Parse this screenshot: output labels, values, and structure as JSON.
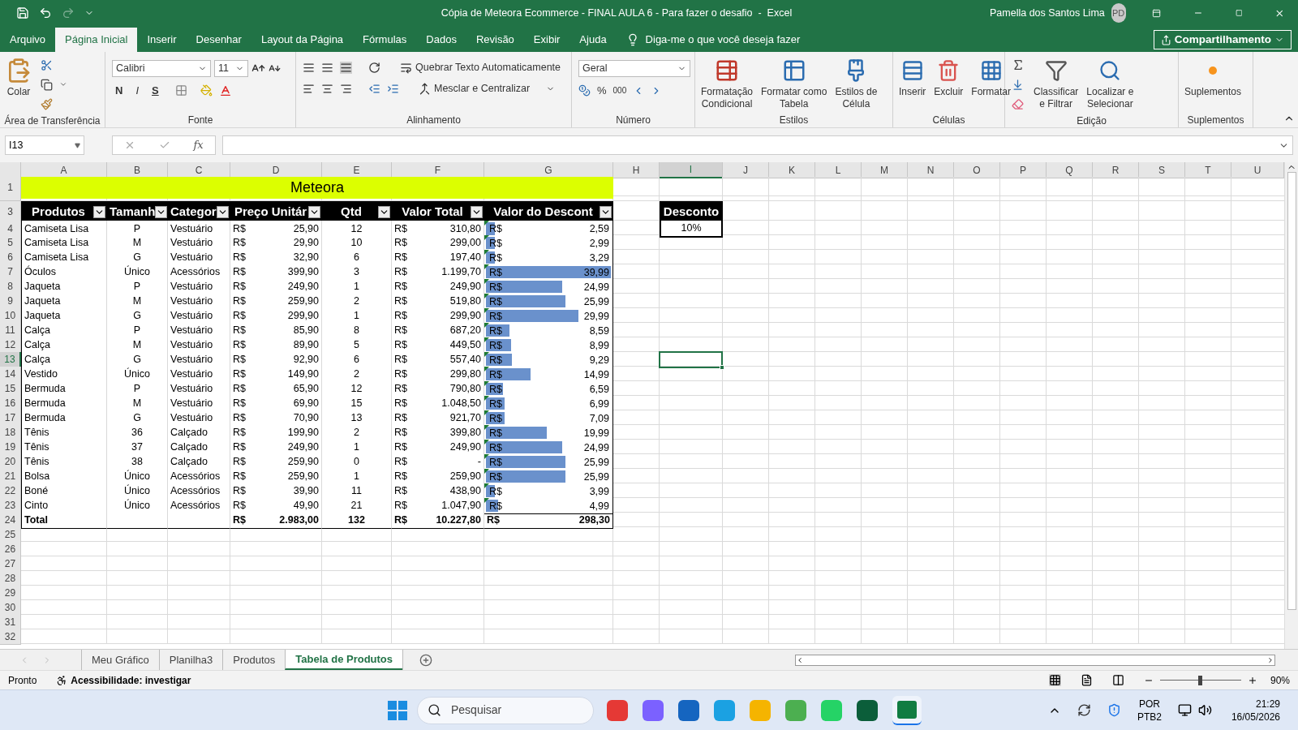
{
  "title_bar": {
    "title": "Cópia de Meteora Ecommerce - FINAL AULA 6 - Para fazer o desafio  -  Excel",
    "user": "Pamella dos Santos Lima",
    "avatar": "PD"
  },
  "menu_tabs": [
    {
      "label": "Arquivo",
      "selected": false
    },
    {
      "label": "Página Inicial",
      "selected": true
    },
    {
      "label": "Inserir",
      "selected": false
    },
    {
      "label": "Desenhar",
      "selected": false
    },
    {
      "label": "Layout da Página",
      "selected": false
    },
    {
      "label": "Fórmulas",
      "selected": false
    },
    {
      "label": "Dados",
      "selected": false
    },
    {
      "label": "Revisão",
      "selected": false
    },
    {
      "label": "Exibir",
      "selected": false
    },
    {
      "label": "Ajuda",
      "selected": false
    }
  ],
  "tell_me": "Diga-me o que você deseja fazer",
  "share_button": "Compartilhamento",
  "ribbon": {
    "clipboard": {
      "label": "Área de Transferência",
      "paste": "Colar"
    },
    "font": {
      "label": "Fonte",
      "font_name": "Calibri",
      "font_size": "11",
      "bold": "N",
      "italic": "I",
      "underline": "S"
    },
    "alignment": {
      "label": "Alinhamento",
      "wrap": "Quebrar Texto Automaticamente",
      "merge": "Mesclar e Centralizar"
    },
    "number": {
      "label": "Número",
      "format": "Geral",
      "percent": "%",
      "thousands": "000"
    },
    "styles": {
      "label": "Estilos",
      "buttons": [
        [
          "Formatação",
          "Condicional"
        ],
        [
          "Formatar como",
          "Tabela"
        ],
        [
          "Estilos de",
          "Célula"
        ]
      ]
    },
    "cells": {
      "label": "Células",
      "buttons": [
        "Inserir",
        "Excluir",
        "Formatar"
      ]
    },
    "editing": {
      "label": "Edição",
      "buttons": [
        [
          "Classificar",
          "e Filtrar"
        ],
        [
          "Localizar e",
          "Selecionar"
        ]
      ]
    },
    "addins": {
      "label": "Suplementos",
      "button": "Suplementos"
    }
  },
  "formula_bar": {
    "name_box": "I13",
    "function_label": "fx"
  },
  "columns": [
    {
      "label": "A",
      "selected": false
    },
    {
      "label": "B",
      "selected": false
    },
    {
      "label": "C",
      "selected": false
    },
    {
      "label": "D",
      "selected": false
    },
    {
      "label": "E",
      "selected": false
    },
    {
      "label": "F",
      "selected": false
    },
    {
      "label": "G",
      "selected": false
    },
    {
      "label": "H",
      "selected": false
    },
    {
      "label": "I",
      "selected": true
    },
    {
      "label": "J",
      "selected": false
    },
    {
      "label": "K",
      "selected": false
    },
    {
      "label": "L",
      "selected": false
    },
    {
      "label": "M",
      "selected": false
    },
    {
      "label": "N",
      "selected": false
    },
    {
      "label": "O",
      "selected": false
    },
    {
      "label": "P",
      "selected": false
    },
    {
      "label": "Q",
      "selected": false
    },
    {
      "label": "R",
      "selected": false
    },
    {
      "label": "S",
      "selected": false
    },
    {
      "label": "T",
      "selected": false
    },
    {
      "label": "U",
      "selected": false
    }
  ],
  "row_headers": [
    {
      "label": "1",
      "selected": false
    },
    {
      "label": "3",
      "selected": false
    },
    {
      "label": "4",
      "selected": false
    },
    {
      "label": "5",
      "selected": false
    },
    {
      "label": "6",
      "selected": false
    },
    {
      "label": "7",
      "selected": false
    },
    {
      "label": "8",
      "selected": false
    },
    {
      "label": "9",
      "selected": false
    },
    {
      "label": "10",
      "selected": false
    },
    {
      "label": "11",
      "selected": false
    },
    {
      "label": "12",
      "selected": false
    },
    {
      "label": "13",
      "selected": true
    },
    {
      "label": "14",
      "selected": false
    },
    {
      "label": "15",
      "selected": false
    },
    {
      "label": "16",
      "selected": false
    },
    {
      "label": "17",
      "selected": false
    },
    {
      "label": "18",
      "selected": false
    },
    {
      "label": "19",
      "selected": false
    },
    {
      "label": "20",
      "selected": false
    },
    {
      "label": "21",
      "selected": false
    },
    {
      "label": "22",
      "selected": false
    },
    {
      "label": "23",
      "selected": false
    },
    {
      "label": "24",
      "selected": false
    },
    {
      "label": "25",
      "selected": false
    },
    {
      "label": "26",
      "selected": false
    },
    {
      "label": "27",
      "selected": false
    },
    {
      "label": "28",
      "selected": false
    },
    {
      "label": "29",
      "selected": false
    },
    {
      "label": "30",
      "selected": false
    },
    {
      "label": "31",
      "selected": false
    },
    {
      "label": "32",
      "selected": false
    }
  ],
  "sheet_title": "Meteora",
  "table_headers": [
    "Produtos",
    "Tamanh",
    "Categor",
    "Preço Unitár",
    "Qtd",
    "Valor Total",
    "Valor do Descont"
  ],
  "rows": [
    {
      "product": "Camiseta Lisa",
      "size": "P",
      "category": "Vestuário",
      "price": {
        "symbol": "R$",
        "amount": "25,90"
      },
      "quantity": "12",
      "total": {
        "symbol": "R$",
        "amount": "310,80"
      },
      "discount": {
        "symbol": "R$",
        "amount": "2,59"
      },
      "level": 0.065,
      "flagged": true
    },
    {
      "product": "Camiseta Lisa",
      "size": "M",
      "category": "Vestuário",
      "price": {
        "symbol": "R$",
        "amount": "29,90"
      },
      "quantity": "10",
      "total": {
        "symbol": "R$",
        "amount": "299,00"
      },
      "discount": {
        "symbol": "R$",
        "amount": "2,99"
      },
      "level": 0.075,
      "flagged": true
    },
    {
      "product": "Camiseta Lisa",
      "size": "G",
      "category": "Vestuário",
      "price": {
        "symbol": "R$",
        "amount": "32,90"
      },
      "quantity": "6",
      "total": {
        "symbol": "R$",
        "amount": "197,40"
      },
      "discount": {
        "symbol": "R$",
        "amount": "3,29"
      },
      "level": 0.082,
      "flagged": true
    },
    {
      "product": "Óculos",
      "size": "Único",
      "category": "Acessórios",
      "price": {
        "symbol": "R$",
        "amount": "399,90"
      },
      "quantity": "3",
      "total": {
        "symbol": "R$",
        "amount": "1.199,70"
      },
      "discount": {
        "symbol": "R$",
        "amount": "39,99"
      },
      "level": 1,
      "flagged": true
    },
    {
      "product": "Jaqueta",
      "size": "P",
      "category": "Vestuário",
      "price": {
        "symbol": "R$",
        "amount": "249,90"
      },
      "quantity": "1",
      "total": {
        "symbol": "R$",
        "amount": "249,90"
      },
      "discount": {
        "symbol": "R$",
        "amount": "24,99"
      },
      "level": 0.625,
      "flagged": true
    },
    {
      "product": "Jaqueta",
      "size": "M",
      "category": "Vestuário",
      "price": {
        "symbol": "R$",
        "amount": "259,90"
      },
      "quantity": "2",
      "total": {
        "symbol": "R$",
        "amount": "519,80"
      },
      "discount": {
        "symbol": "R$",
        "amount": "25,99"
      },
      "level": 0.65,
      "flagged": true
    },
    {
      "product": "Jaqueta",
      "size": "G",
      "category": "Vestuário",
      "price": {
        "symbol": "R$",
        "amount": "299,90"
      },
      "quantity": "1",
      "total": {
        "symbol": "R$",
        "amount": "299,90"
      },
      "discount": {
        "symbol": "R$",
        "amount": "29,99"
      },
      "level": 0.75,
      "flagged": true
    },
    {
      "product": "Calça",
      "size": "P",
      "category": "Vestuário",
      "price": {
        "symbol": "R$",
        "amount": "85,90"
      },
      "quantity": "8",
      "total": {
        "symbol": "R$",
        "amount": "687,20"
      },
      "discount": {
        "symbol": "R$",
        "amount": "8,59"
      },
      "level": 0.215,
      "flagged": true
    },
    {
      "product": "Calça",
      "size": "M",
      "category": "Vestuário",
      "price": {
        "symbol": "R$",
        "amount": "89,90"
      },
      "quantity": "5",
      "total": {
        "symbol": "R$",
        "amount": "449,50"
      },
      "discount": {
        "symbol": "R$",
        "amount": "8,99"
      },
      "level": 0.225,
      "flagged": true
    },
    {
      "product": "Calça",
      "size": "G",
      "category": "Vestuário",
      "price": {
        "symbol": "R$",
        "amount": "92,90"
      },
      "quantity": "6",
      "total": {
        "symbol": "R$",
        "amount": "557,40"
      },
      "discount": {
        "symbol": "R$",
        "amount": "9,29"
      },
      "level": 0.232,
      "flagged": true
    },
    {
      "product": "Vestido",
      "size": "Único",
      "category": "Vestuário",
      "price": {
        "symbol": "R$",
        "amount": "149,90"
      },
      "quantity": "2",
      "total": {
        "symbol": "R$",
        "amount": "299,80"
      },
      "discount": {
        "symbol": "R$",
        "amount": "14,99"
      },
      "level": 0.375,
      "flagged": true
    },
    {
      "product": "Bermuda",
      "size": "P",
      "category": "Vestuário",
      "price": {
        "symbol": "R$",
        "amount": "65,90"
      },
      "quantity": "12",
      "total": {
        "symbol": "R$",
        "amount": "790,80"
      },
      "discount": {
        "symbol": "R$",
        "amount": "6,59"
      },
      "level": 0.165,
      "flagged": true
    },
    {
      "product": "Bermuda",
      "size": "M",
      "category": "Vestuário",
      "price": {
        "symbol": "R$",
        "amount": "69,90"
      },
      "quantity": "15",
      "total": {
        "symbol": "R$",
        "amount": "1.048,50"
      },
      "discount": {
        "symbol": "R$",
        "amount": "6,99"
      },
      "level": 0.175,
      "flagged": true
    },
    {
      "product": "Bermuda",
      "size": "G",
      "category": "Vestuário",
      "price": {
        "symbol": "R$",
        "amount": "70,90"
      },
      "quantity": "13",
      "total": {
        "symbol": "R$",
        "amount": "921,70"
      },
      "discount": {
        "symbol": "R$",
        "amount": "7,09"
      },
      "level": 0.177,
      "flagged": true
    },
    {
      "product": "Tênis",
      "size": "36",
      "category": "Calçado",
      "price": {
        "symbol": "R$",
        "amount": "199,90"
      },
      "quantity": "2",
      "total": {
        "symbol": "R$",
        "amount": "399,80"
      },
      "discount": {
        "symbol": "R$",
        "amount": "19,99"
      },
      "level": 0.5,
      "flagged": true
    },
    {
      "product": "Tênis",
      "size": "37",
      "category": "Calçado",
      "price": {
        "symbol": "R$",
        "amount": "249,90"
      },
      "quantity": "1",
      "total": {
        "symbol": "R$",
        "amount": "249,90"
      },
      "discount": {
        "symbol": "R$",
        "amount": "24,99"
      },
      "level": 0.625,
      "flagged": true
    },
    {
      "product": "Tênis",
      "size": "38",
      "category": "Calçado",
      "price": {
        "symbol": "R$",
        "amount": "259,90"
      },
      "quantity": "0",
      "total": {
        "symbol": "R$",
        "amount": "-"
      },
      "discount": {
        "symbol": "R$",
        "amount": "25,99"
      },
      "level": 0.65,
      "flagged": true
    },
    {
      "product": "Bolsa",
      "size": "Único",
      "category": "Acessórios",
      "price": {
        "symbol": "R$",
        "amount": "259,90"
      },
      "quantity": "1",
      "total": {
        "symbol": "R$",
        "amount": "259,90"
      },
      "discount": {
        "symbol": "R$",
        "amount": "25,99"
      },
      "level": 0.65,
      "flagged": true
    },
    {
      "product": "Boné",
      "size": "Único",
      "category": "Acessórios",
      "price": {
        "symbol": "R$",
        "amount": "39,90"
      },
      "quantity": "11",
      "total": {
        "symbol": "R$",
        "amount": "438,90"
      },
      "discount": {
        "symbol": "R$",
        "amount": "3,99"
      },
      "level": 0.1,
      "flagged": true
    },
    {
      "product": "Cinto",
      "size": "Único",
      "category": "Acessórios",
      "price": {
        "symbol": "R$",
        "amount": "49,90"
      },
      "quantity": "21",
      "total": {
        "symbol": "R$",
        "amount": "1.047,90"
      },
      "discount": {
        "symbol": "R$",
        "amount": "4,99"
      },
      "level": 0.125,
      "flagged": true
    }
  ],
  "total_row": {
    "label": "Total",
    "price": {
      "symbol": "R$",
      "amount": "2.983,00"
    },
    "quantity": "132",
    "total": {
      "symbol": "R$",
      "amount": "10.227,80"
    },
    "discount": {
      "symbol": "R$",
      "amount": "298,30"
    }
  },
  "discount_box": {
    "header": "Desconto",
    "value": "10%"
  },
  "sheet_tabs": [
    {
      "label": "Meu Gráfico",
      "selected": false
    },
    {
      "label": "Planilha3",
      "selected": false
    },
    {
      "label": "Produtos",
      "selected": false
    },
    {
      "label": "Tabela de Produtos",
      "selected": true
    }
  ],
  "status_bar": {
    "status": "Pronto",
    "accessibility": "Acessibilidade: investigar",
    "zoom": "90%",
    "zoom_slider": {
      "level": 0.49
    }
  },
  "taskbar": {
    "search_placeholder": "Pesquisar",
    "language": "POR",
    "layout": "PTB2",
    "time": "21:29",
    "date": "16/05/2026"
  }
}
